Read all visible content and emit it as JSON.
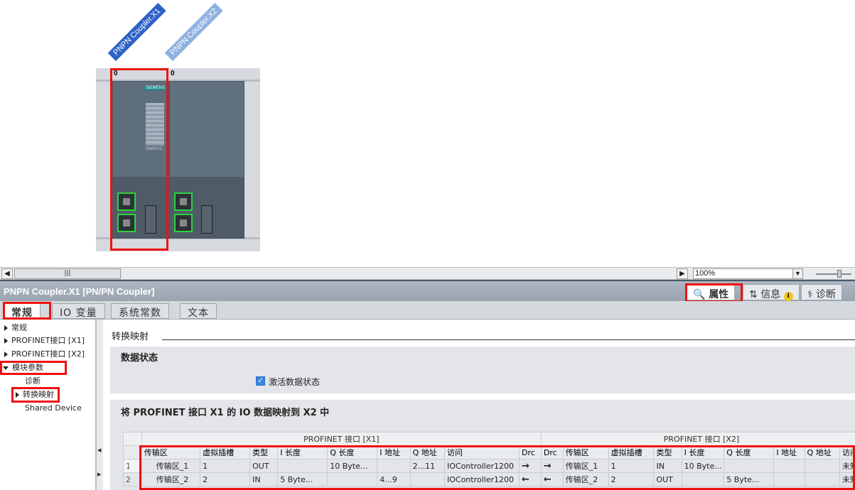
{
  "device": {
    "tags": [
      "PNPN Coupler.X1",
      "PNPN Coupler.X2"
    ],
    "slot_numbers": [
      "0",
      "0"
    ],
    "brand": "SIEMENS",
    "product": "SIMATIC",
    "colors": {
      "tag_active": "#2f62c7",
      "tag_inactive": "#8fb1e2",
      "port_border": "#2bd43d",
      "highlight": "#e11111"
    }
  },
  "scroll": {
    "zoom": "100%"
  },
  "inspector": {
    "title": "PNPN Coupler.X1 [PN/PN Coupler]",
    "tabs": [
      "属性",
      "信息",
      "诊断"
    ]
  },
  "prop_tabs": [
    "常规",
    "IO 变量",
    "系统常数",
    "文本"
  ],
  "nav": {
    "items": [
      "常规",
      "PROFINET接口 [X1]",
      "PROFINET接口 [X2]",
      "模块参数",
      "诊断",
      "转换映射",
      "Shared Device"
    ]
  },
  "content": {
    "section_title": "转换映射",
    "data_status": {
      "title": "数据状态",
      "checkbox_label": "激活数据状态",
      "checked": true
    },
    "mapping": {
      "title": "将 PROFINET 接口 X1 的 IO 数据映射到 X2 中",
      "group_left": "PROFINET 接口 [X1]",
      "group_right": "PROFINET 接口 [X2]",
      "headers_left": [
        "传输区",
        "虚拟插槽",
        "类型",
        "I 长度",
        "Q 长度",
        "I 地址",
        "Q 地址",
        "访问",
        "Drc"
      ],
      "headers_right": [
        "Drc",
        "传输区",
        "虚拟插槽",
        "类型",
        "I 长度",
        "Q 长度",
        "I 地址",
        "Q 地址",
        "访问"
      ],
      "rows": [
        {
          "num": "1",
          "left": [
            "传输区_1",
            "1",
            "OUT",
            "",
            "10    Byte...",
            "",
            "2...11",
            "IOController1200",
            "→"
          ],
          "right": [
            "→",
            "传输区_1",
            "1",
            "IN",
            "10    Byte...",
            "",
            "",
            "",
            "未知"
          ]
        },
        {
          "num": "2",
          "left": [
            "传输区_2",
            "2",
            "IN",
            "5    Byte...",
            "",
            "4...9",
            "",
            "IOController1200",
            "←"
          ],
          "right": [
            "←",
            "传输区_2",
            "2",
            "OUT",
            "",
            "5    Byte...",
            "",
            "",
            "未知"
          ]
        }
      ]
    }
  }
}
